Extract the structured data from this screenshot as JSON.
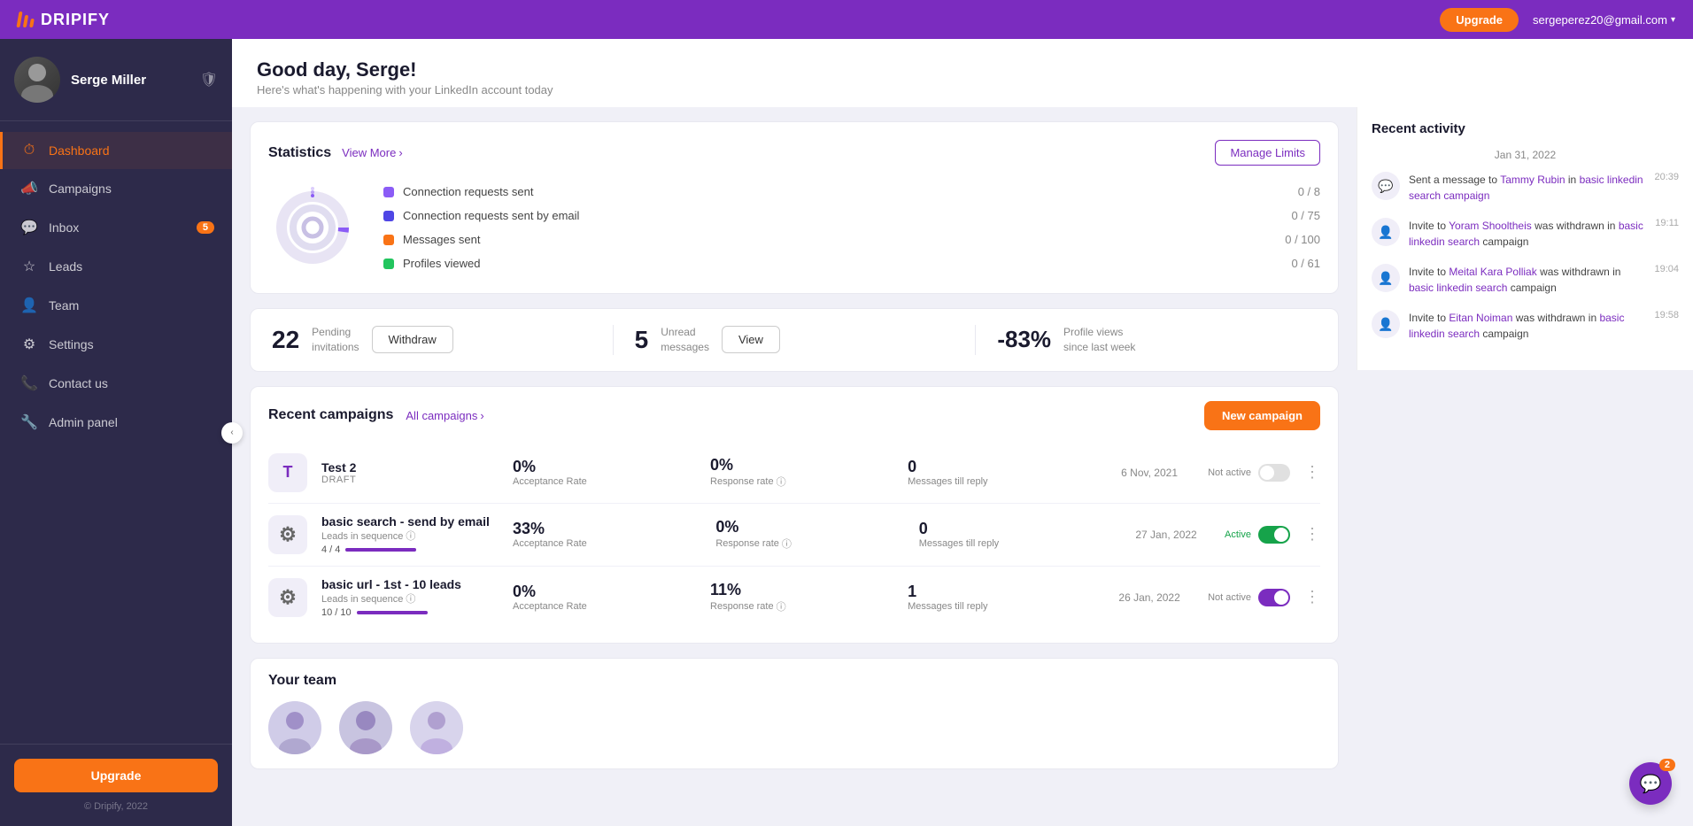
{
  "topnav": {
    "logo_text": "DRIPIFY",
    "upgrade_label": "Upgrade",
    "user_email": "sergeperez20@gmail.com"
  },
  "sidebar": {
    "user_name": "Serge Miller",
    "nav_items": [
      {
        "id": "dashboard",
        "label": "Dashboard",
        "icon": "⏱",
        "active": true,
        "badge": null
      },
      {
        "id": "campaigns",
        "label": "Campaigns",
        "icon": "📣",
        "active": false,
        "badge": null
      },
      {
        "id": "inbox",
        "label": "Inbox",
        "icon": "💬",
        "active": false,
        "badge": "5"
      },
      {
        "id": "leads",
        "label": "Leads",
        "icon": "☆",
        "active": false,
        "badge": null
      },
      {
        "id": "team",
        "label": "Team",
        "icon": "👤",
        "active": false,
        "badge": null
      },
      {
        "id": "settings",
        "label": "Settings",
        "icon": "⚙",
        "active": false,
        "badge": null
      },
      {
        "id": "contact-us",
        "label": "Contact us",
        "icon": "📞",
        "active": false,
        "badge": null
      },
      {
        "id": "admin-panel",
        "label": "Admin panel",
        "icon": "🔧",
        "active": false,
        "badge": null
      }
    ],
    "upgrade_label": "Upgrade",
    "copyright": "© Dripify, 2022"
  },
  "header": {
    "greeting": "Good day, Serge!",
    "subtitle": "Here's what's happening with your LinkedIn account today"
  },
  "statistics": {
    "title": "Statistics",
    "view_more": "View More",
    "manage_limits": "Manage Limits",
    "items": [
      {
        "label": "Connection requests sent",
        "color": "#8b5cf6",
        "value": "0 / 8"
      },
      {
        "label": "Connection requests sent by email",
        "color": "#4f46e5",
        "value": "0 / 75"
      },
      {
        "label": "Messages sent",
        "color": "#f97316",
        "value": "0 / 100"
      },
      {
        "label": "Profiles viewed",
        "color": "#22c55e",
        "value": "0 / 61"
      }
    ]
  },
  "metrics": [
    {
      "number": "22",
      "label": "Pending\ninvitations",
      "action": "Withdraw"
    },
    {
      "number": "5",
      "label": "Unread\nmessages",
      "action": "View"
    },
    {
      "percent": "-83%",
      "label": "Profile views\nsince last week"
    }
  ],
  "recent_campaigns": {
    "title": "Recent campaigns",
    "all_campaigns_label": "All campaigns",
    "new_campaign_label": "New campaign",
    "campaigns": [
      {
        "icon": "T",
        "icon_type": "letter",
        "name": "Test 2",
        "status": "DRAFT",
        "leads_label": null,
        "leads_progress": null,
        "acceptance_rate": "0%",
        "response_rate": "0%",
        "messages_till_reply": "0",
        "date": "6 Nov, 2021",
        "active": false,
        "active_label": "Not active"
      },
      {
        "icon": "⚙",
        "icon_type": "gear",
        "name": "basic search - send by email",
        "status": null,
        "leads_label": "Leads in sequence",
        "leads_text": "4 / 4",
        "leads_progress": 100,
        "acceptance_rate": "33%",
        "response_rate": "0%",
        "messages_till_reply": "0",
        "date": "27 Jan, 2022",
        "active": true,
        "active_label": "Active"
      },
      {
        "icon": "⚙",
        "icon_type": "gear",
        "name": "basic url - 1st - 10 leads",
        "status": null,
        "leads_label": "Leads in sequence",
        "leads_text": "10 / 10",
        "leads_progress": 100,
        "acceptance_rate": "0%",
        "response_rate": "11%",
        "messages_till_reply": "1",
        "date": "26 Jan, 2022",
        "active": false,
        "active_label": "Not active"
      }
    ]
  },
  "your_team": {
    "title": "Your team"
  },
  "recent_activity": {
    "title": "Recent activity",
    "date_divider": "Jan 31, 2022",
    "items": [
      {
        "icon": "💬",
        "text_before": "Sent a message to ",
        "link1": "Tammy Rubin",
        "text_middle": " in ",
        "link2": "basic linkedin search campaign",
        "time": "20:39"
      },
      {
        "icon": "👤",
        "text_before": "Invite to ",
        "link1": "Yoram Shooltheis",
        "text_middle": " was withdrawn in ",
        "link2": "basic linkedin search",
        "text_after": " campaign",
        "time": "19:11"
      },
      {
        "icon": "👤",
        "text_before": "Invite to ",
        "link1": "Meital Kara Polliak",
        "text_middle": " was withdrawn in ",
        "link2": "basic linkedin search",
        "text_after": " campaign",
        "time": "19:04"
      },
      {
        "icon": "👤",
        "text_before": "Invite to ",
        "link1": "Eitan Noiman",
        "text_middle": " was withdrawn in ",
        "link2": "basic linkedin search",
        "text_after": " campaign",
        "time": "19:58"
      }
    ]
  },
  "chat": {
    "badge": "2"
  }
}
